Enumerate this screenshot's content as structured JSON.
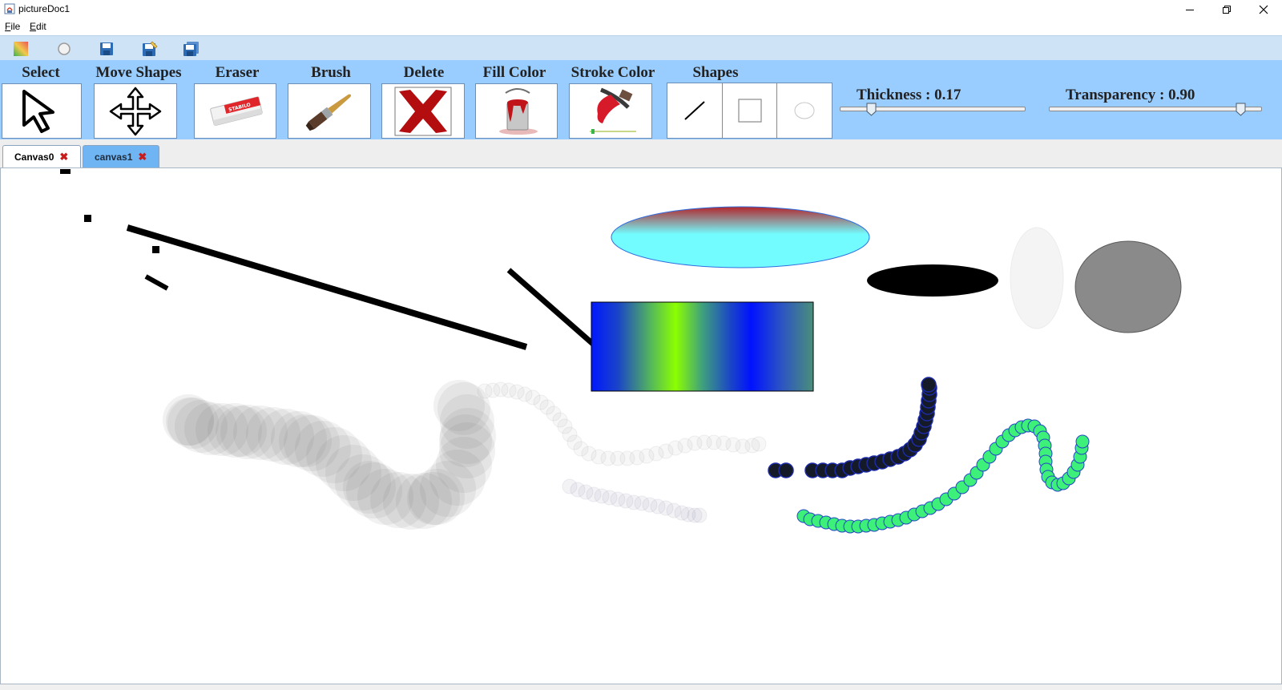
{
  "window": {
    "title": "pictureDoc1",
    "controls": [
      "minimize-icon",
      "restore-icon",
      "close-icon"
    ]
  },
  "menu": {
    "file": "File",
    "edit": "Edit"
  },
  "quick_toolbar": {
    "buttons": [
      "gradient-icon",
      "circle-icon",
      "save-icon",
      "save-as-icon",
      "save-all-icon"
    ]
  },
  "toolbar": {
    "select_label": "Select",
    "move_label": "Move Shapes",
    "eraser_label": "Eraser",
    "brush_label": "Brush",
    "delete_label": "Delete",
    "fill_color_label": "Fill Color",
    "stroke_color_label": "Stroke Color",
    "shapes_label": "Shapes",
    "eraser_brand": "STABILO",
    "shape_options": [
      "line-icon",
      "rectangle-icon",
      "ellipse-icon"
    ]
  },
  "sliders": {
    "thickness_label": "Thickness : 0.17",
    "thickness_value": 0.17,
    "transparency_label": "Transparency : 0.90",
    "transparency_value": 0.9
  },
  "tabs": [
    {
      "label": "Canvas0",
      "active": true
    },
    {
      "label": "canvas1",
      "active": false
    }
  ],
  "colors": {
    "toolbar_bg": "#99ccff",
    "quickbar_bg": "#cfe3f6",
    "tab_inactive": "#6fb4f3",
    "tab_close": "#c81c1c",
    "ellipse_fill": "#72fcff",
    "ellipse_stroke_top": "#b3262c",
    "gray_ellipse": "#8a8a8a",
    "green_stroke": "#3df07a",
    "dark_stroke": "#121826"
  }
}
